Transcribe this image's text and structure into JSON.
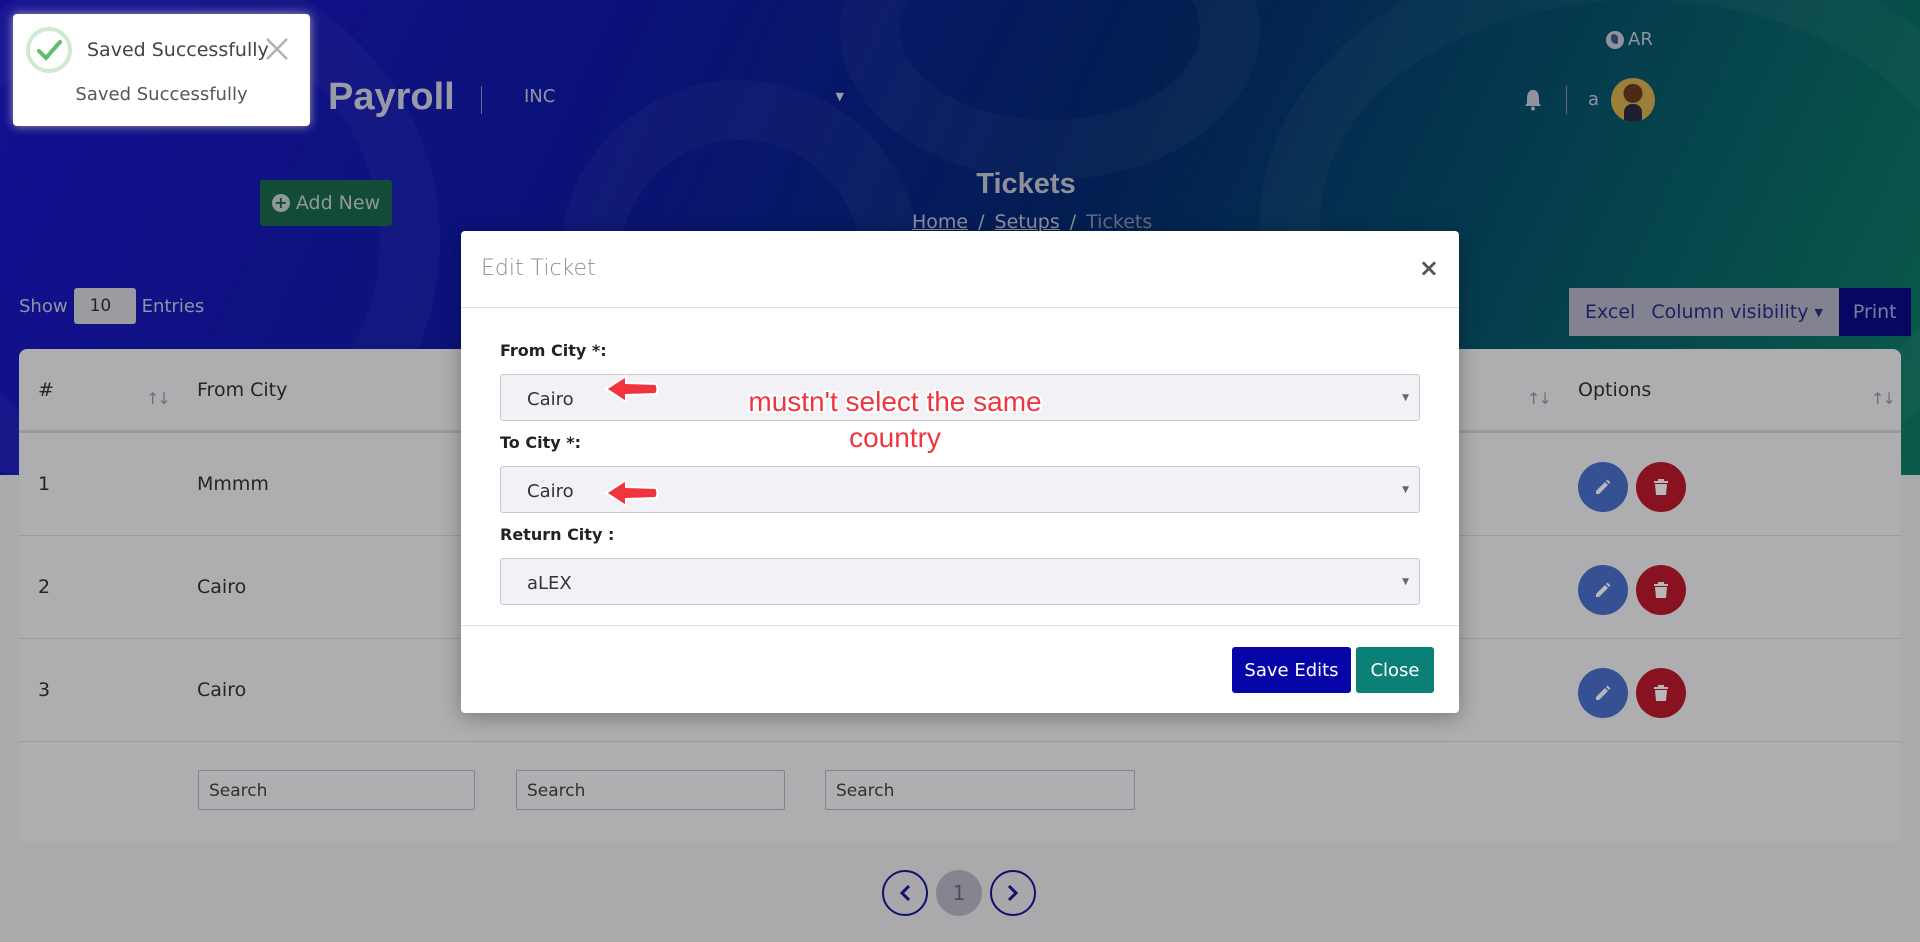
{
  "app": {
    "brand": "Payroll",
    "company": "INC",
    "language": "AR",
    "user_name": "a"
  },
  "page": {
    "title": "Tickets",
    "breadcrumb": [
      "Home",
      "Setups",
      "Tickets"
    ],
    "breadcrumb_sep": "/",
    "add_new_label": "Add New"
  },
  "table_controls": {
    "show_label": "Show",
    "page_size": "10",
    "entries_label": "Entries",
    "excel_label": "Excel",
    "column_visibility_label": "Column visibility",
    "print_label": "Print"
  },
  "table": {
    "columns": [
      "#",
      "From City",
      "Options"
    ],
    "rows": [
      {
        "index": "1",
        "from_city": "Mmmm"
      },
      {
        "index": "2",
        "from_city": "Cairo"
      },
      {
        "index": "3",
        "from_city": "Cairo"
      }
    ],
    "search_placeholder": "Search"
  },
  "pagination": {
    "current_page": "1"
  },
  "modal": {
    "title": "Edit Ticket",
    "close_symbol": "×",
    "fields": [
      {
        "label": "From City *:",
        "value": "Cairo"
      },
      {
        "label": "To City *:",
        "value": "Cairo"
      },
      {
        "label": "Return City :",
        "value": "aLEX"
      }
    ],
    "save_label": "Save Edits",
    "close_label": "Close"
  },
  "annotation": {
    "text_line1": "mustn't select the same",
    "text_line2": "country",
    "color": "#f0353e"
  },
  "toast": {
    "title": "Saved Successfully",
    "message": "Saved Successfully",
    "icon": "check-icon"
  },
  "colors": {
    "save_button": "#0505a8",
    "close_button": "#0b8077",
    "edit_action": "#4b6fce",
    "delete_action": "#bd1a2c",
    "add_new_button": "#1a6a4c"
  }
}
